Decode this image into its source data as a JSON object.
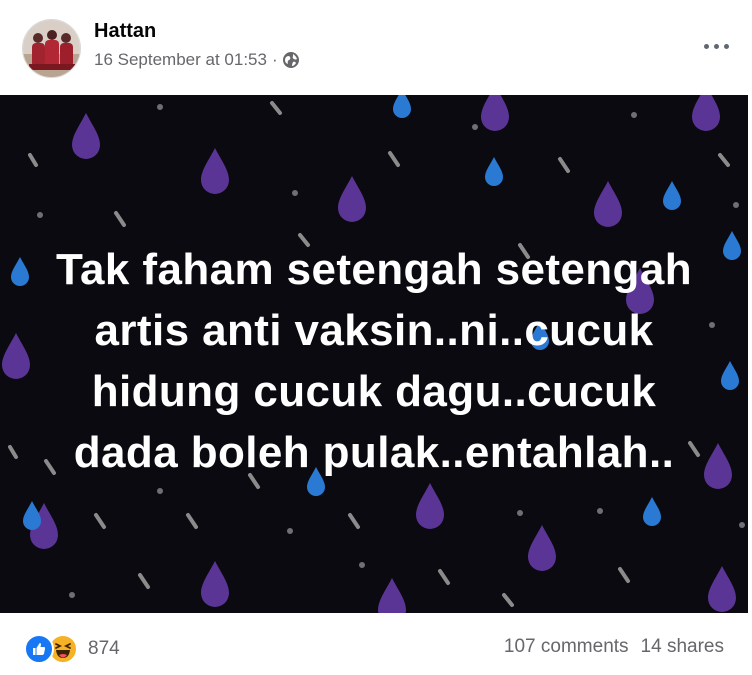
{
  "post": {
    "author": "Hattan",
    "timestamp": "16 September at 01:53",
    "separator": "·",
    "privacy_icon": "globe-icon",
    "menu_icon": "more-horizontal-icon"
  },
  "image": {
    "text": "Tak faham setengah setengah artis anti vaksin..ni..cucuk hidung cucuk dagu..cucuk dada boleh pulak..entahlah..",
    "background_color": "#0b0a10",
    "drop_colors": [
      "#6b3fa0",
      "#2c7bd6",
      "#8a8a8a"
    ]
  },
  "footer": {
    "reaction_icons": [
      "like-icon",
      "haha-icon"
    ],
    "reaction_count": "874",
    "comments": "107 comments",
    "shares": "14 shares"
  },
  "colors": {
    "like_blue": "#1877f2",
    "haha_yellow": "#f7b125",
    "meta_gray": "#65676b"
  }
}
